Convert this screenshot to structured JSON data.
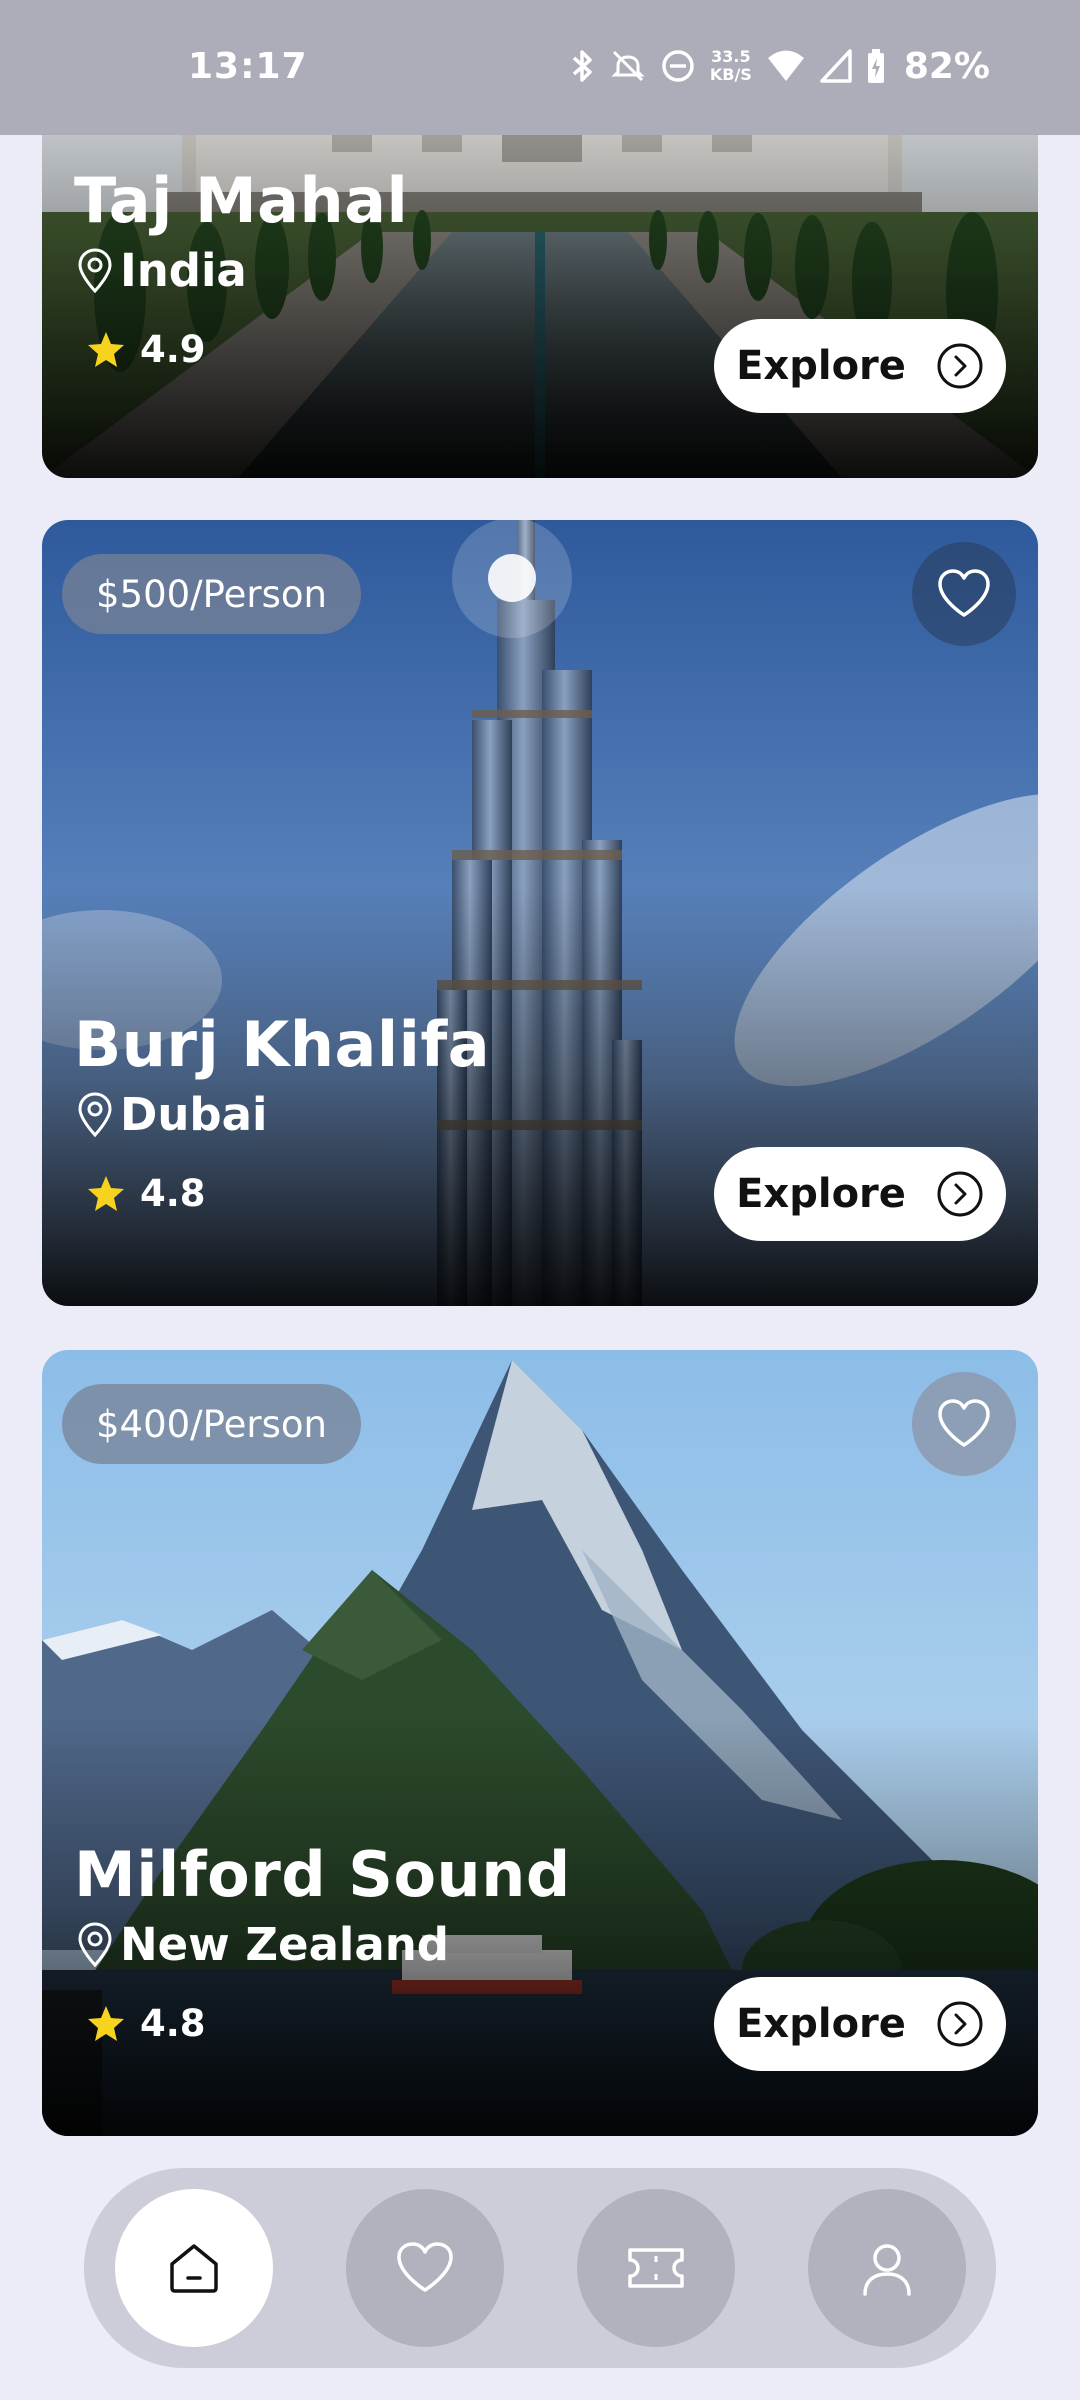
{
  "status_bar": {
    "time": "13:17",
    "net_speed_value": "33.5",
    "net_speed_unit": "KB/S",
    "battery": "82%"
  },
  "destinations": [
    {
      "name": "Taj Mahal",
      "location": "India",
      "rating": "4.9",
      "explore_label": "Explore"
    },
    {
      "price": "$500/Person",
      "name": "Burj Khalifa",
      "location": "Dubai",
      "rating": "4.8",
      "explore_label": "Explore"
    },
    {
      "price": "$400/Person",
      "name": "Milford Sound",
      "location": "New Zealand",
      "rating": "4.8",
      "explore_label": "Explore"
    }
  ],
  "nav": {
    "items": [
      {
        "icon": "home-icon",
        "active": true
      },
      {
        "icon": "heart-icon",
        "active": false
      },
      {
        "icon": "ticket-icon",
        "active": false
      },
      {
        "icon": "user-icon",
        "active": false
      }
    ]
  },
  "colors": {
    "background": "#ececf8",
    "status_bar": "#adadb9",
    "star": "#f7d21e",
    "nav_bar": "#cdcdd9",
    "nav_button": "#b2b2be"
  }
}
